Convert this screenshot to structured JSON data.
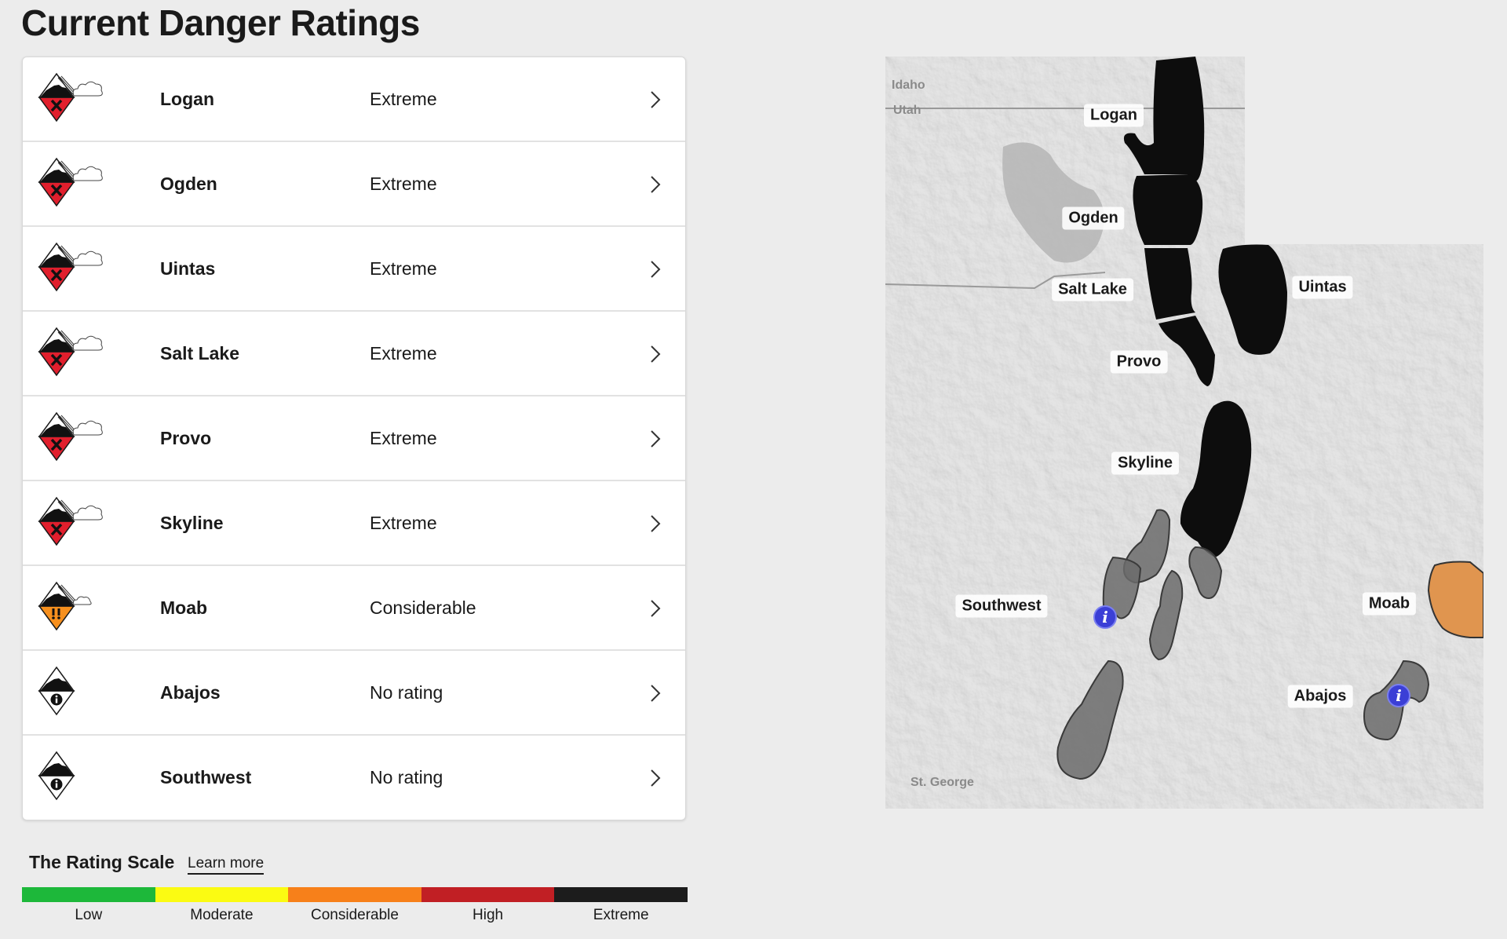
{
  "page_title": "Current Danger Ratings",
  "regions": [
    {
      "name": "Logan",
      "rating": "Extreme",
      "icon": "extreme-danger-icon"
    },
    {
      "name": "Ogden",
      "rating": "Extreme",
      "icon": "extreme-danger-icon"
    },
    {
      "name": "Uintas",
      "rating": "Extreme",
      "icon": "extreme-danger-icon"
    },
    {
      "name": "Salt Lake",
      "rating": "Extreme",
      "icon": "extreme-danger-icon"
    },
    {
      "name": "Provo",
      "rating": "Extreme",
      "icon": "extreme-danger-icon"
    },
    {
      "name": "Skyline",
      "rating": "Extreme",
      "icon": "extreme-danger-icon"
    },
    {
      "name": "Moab",
      "rating": "Considerable",
      "icon": "considerable-danger-icon"
    },
    {
      "name": "Abajos",
      "rating": "No rating",
      "icon": "no-rating-icon"
    },
    {
      "name": "Southwest",
      "rating": "No rating",
      "icon": "no-rating-icon"
    }
  ],
  "rating_scale": {
    "title": "The Rating Scale",
    "learn_more": "Learn more",
    "levels": [
      {
        "label": "Low",
        "color": "#1db83a"
      },
      {
        "label": "Moderate",
        "color": "#fbfb12"
      },
      {
        "label": "Considerable",
        "color": "#f7801a"
      },
      {
        "label": "High",
        "color": "#c11f24"
      },
      {
        "label": "Extreme",
        "color": "#1c1c1c"
      }
    ]
  },
  "colors": {
    "extreme": "#e11f2d",
    "considerable": "#f7901e",
    "no_rating": "#ffffff",
    "zone_extreme": "#0d0d0d",
    "zone_considerable": "#e0954f",
    "zone_no_rating": "#6b6b6b",
    "info_pin": "#3b3fd6"
  },
  "map": {
    "place_labels": {
      "idaho": "Idaho",
      "utah": "Utah",
      "st_george": "St. George"
    },
    "zone_labels": {
      "logan": "Logan",
      "ogden": "Ogden",
      "salt_lake": "Salt Lake",
      "uintas": "Uintas",
      "provo": "Provo",
      "skyline": "Skyline",
      "southwest": "Southwest",
      "moab": "Moab",
      "abajos": "Abajos"
    },
    "info_pin_glyph": "i"
  }
}
